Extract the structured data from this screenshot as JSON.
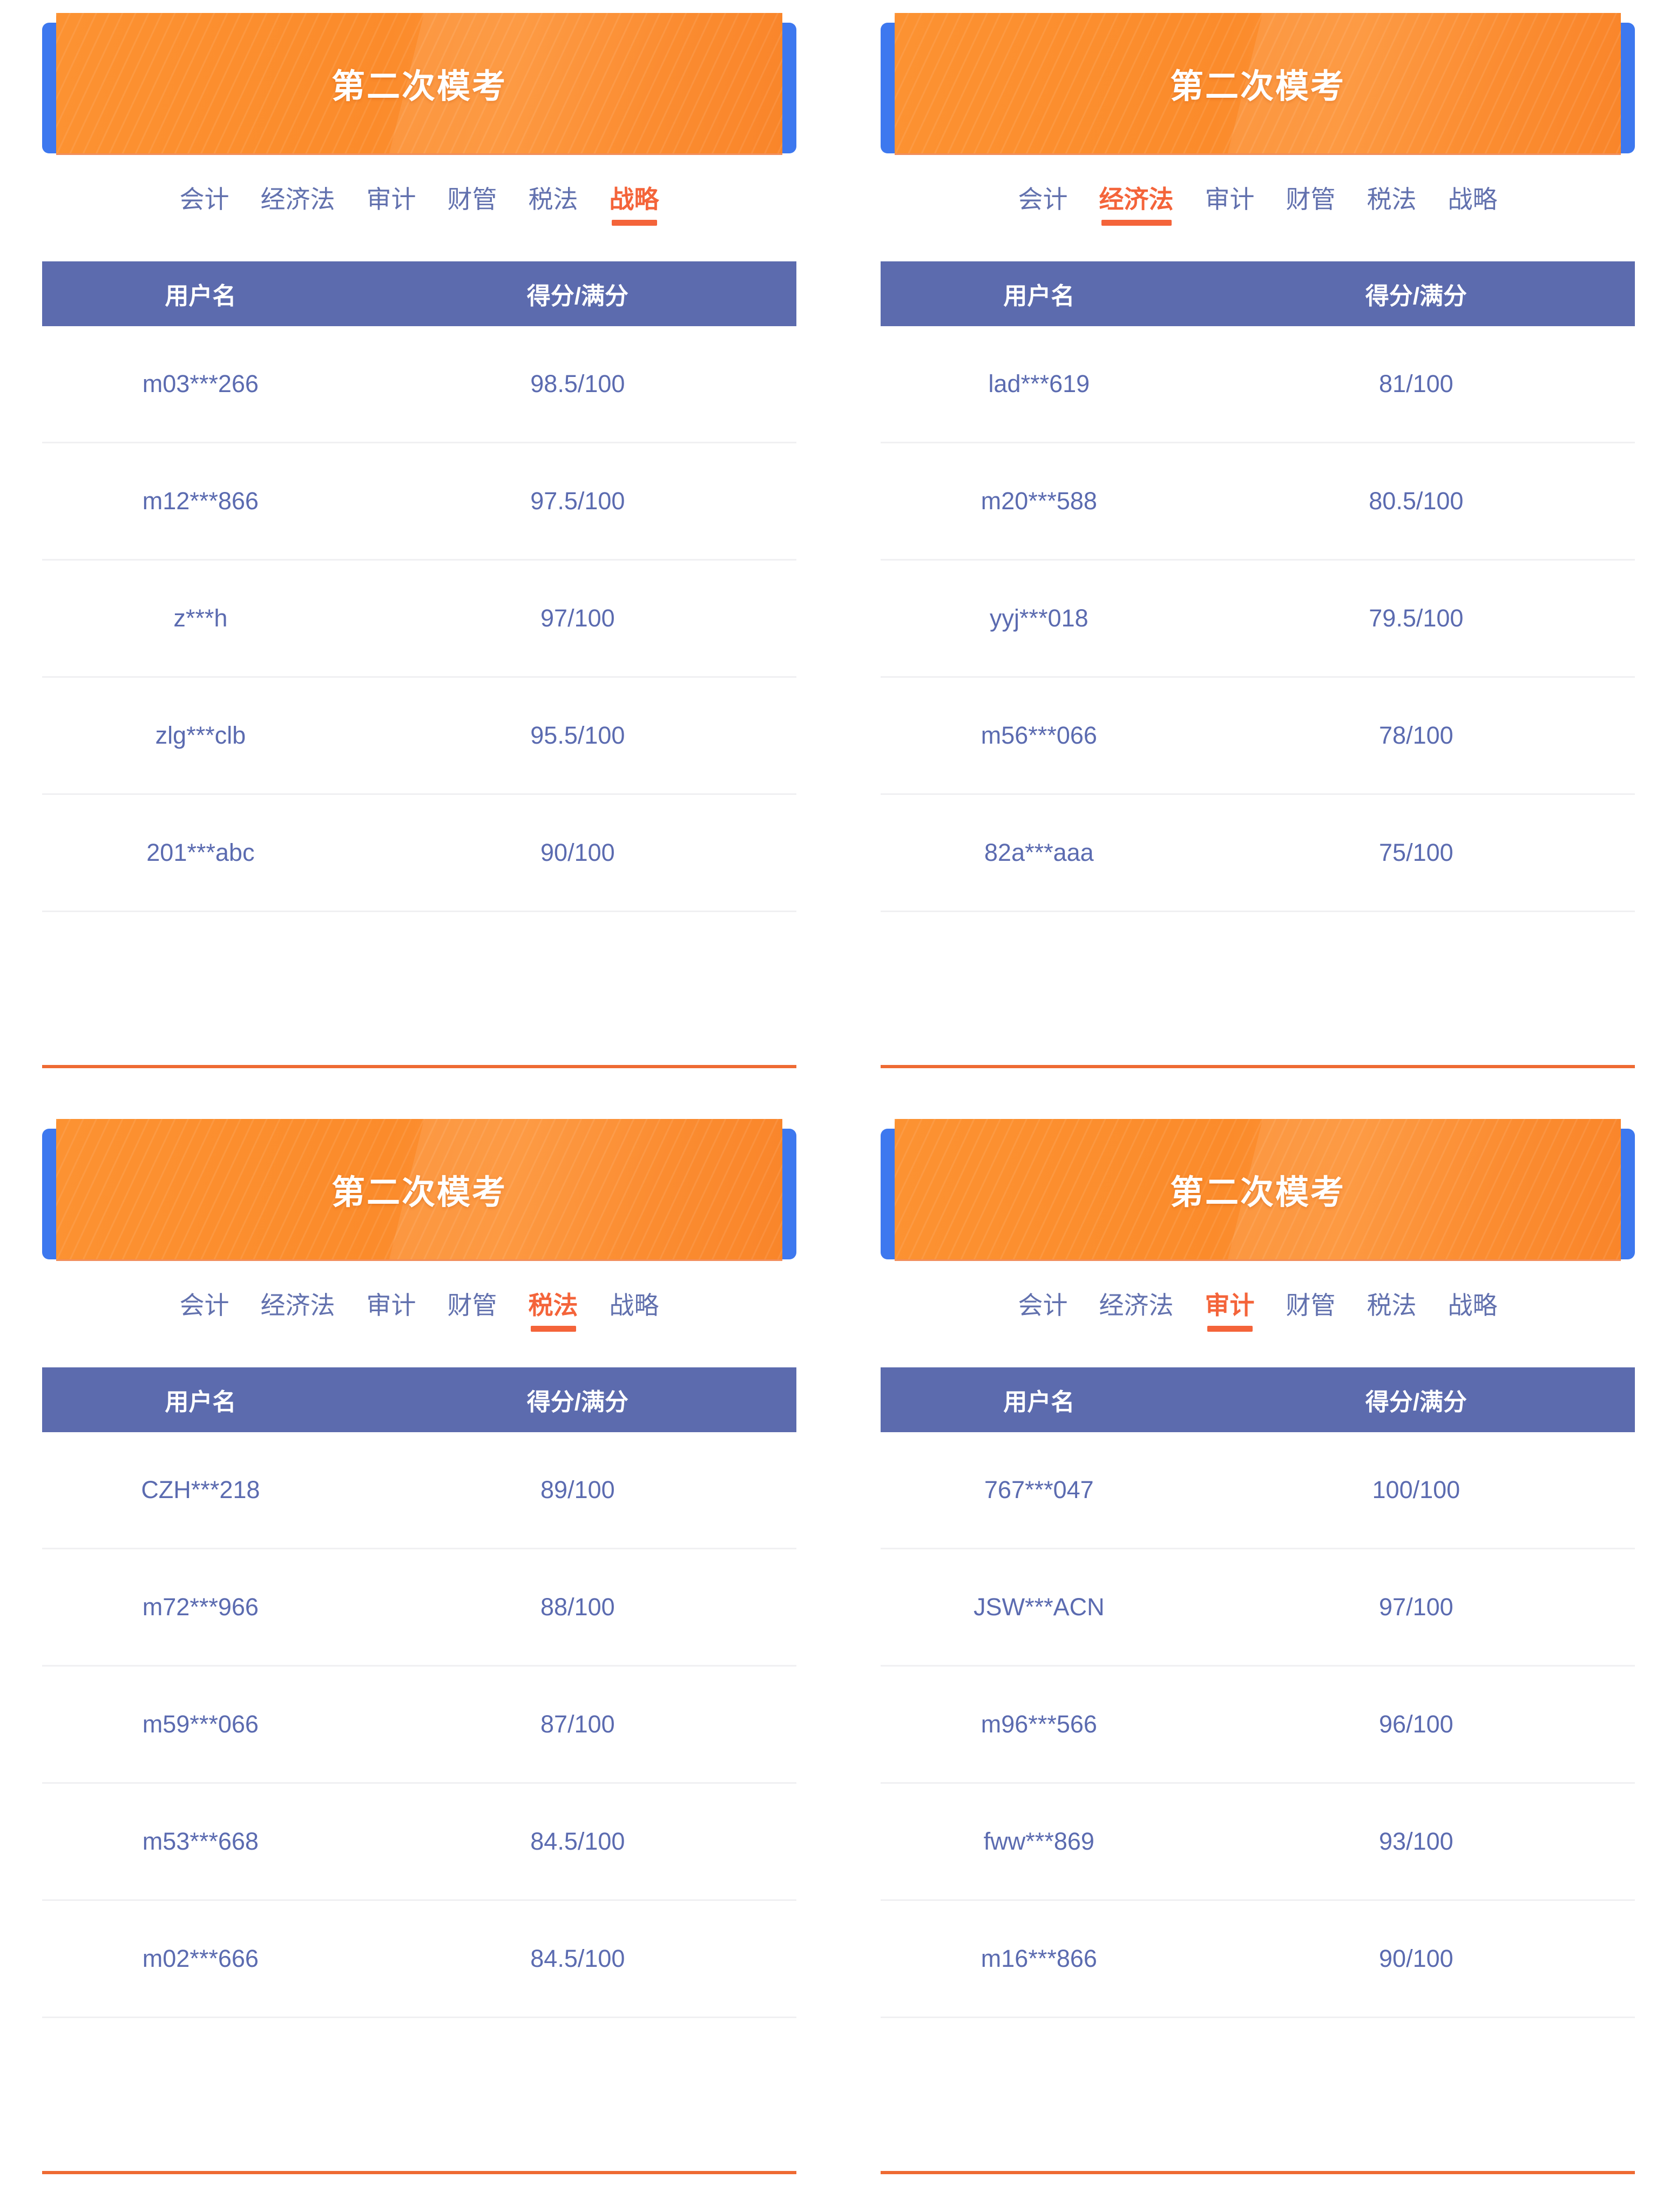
{
  "accent_colors": {
    "banner_orange": "#fb8b2b",
    "banner_ear_blue": "#3d78ef",
    "active_tab_orange": "#f4643a",
    "table_header_blue": "#5c6bae",
    "row_text_blue": "#5b6bb0",
    "panel_divider_orange": "#ee6a33"
  },
  "panels": [
    {
      "banner_title": "第二次模考",
      "tabs": [
        {
          "label": "会计",
          "active": false
        },
        {
          "label": "经济法",
          "active": false
        },
        {
          "label": "审计",
          "active": false
        },
        {
          "label": "财管",
          "active": false
        },
        {
          "label": "税法",
          "active": false
        },
        {
          "label": "战略",
          "active": true
        }
      ],
      "columns": {
        "user": "用户名",
        "score": "得分/满分"
      },
      "rows": [
        {
          "user": "m03***266",
          "score": "98.5/100"
        },
        {
          "user": "m12***866",
          "score": "97.5/100"
        },
        {
          "user": "z***h",
          "score": "97/100"
        },
        {
          "user": "zlg***clb",
          "score": "95.5/100"
        },
        {
          "user": "201***abc",
          "score": "90/100"
        }
      ]
    },
    {
      "banner_title": "第二次模考",
      "tabs": [
        {
          "label": "会计",
          "active": false
        },
        {
          "label": "经济法",
          "active": true
        },
        {
          "label": "审计",
          "active": false
        },
        {
          "label": "财管",
          "active": false
        },
        {
          "label": "税法",
          "active": false
        },
        {
          "label": "战略",
          "active": false
        }
      ],
      "columns": {
        "user": "用户名",
        "score": "得分/满分"
      },
      "rows": [
        {
          "user": "lad***619",
          "score": "81/100"
        },
        {
          "user": "m20***588",
          "score": "80.5/100"
        },
        {
          "user": "yyj***018",
          "score": "79.5/100"
        },
        {
          "user": "m56***066",
          "score": "78/100"
        },
        {
          "user": "82a***aaa",
          "score": "75/100"
        }
      ]
    },
    {
      "banner_title": "第二次模考",
      "tabs": [
        {
          "label": "会计",
          "active": false
        },
        {
          "label": "经济法",
          "active": false
        },
        {
          "label": "审计",
          "active": false
        },
        {
          "label": "财管",
          "active": false
        },
        {
          "label": "税法",
          "active": true
        },
        {
          "label": "战略",
          "active": false
        }
      ],
      "columns": {
        "user": "用户名",
        "score": "得分/满分"
      },
      "rows": [
        {
          "user": "CZH***218",
          "score": "89/100"
        },
        {
          "user": "m72***966",
          "score": "88/100"
        },
        {
          "user": "m59***066",
          "score": "87/100"
        },
        {
          "user": "m53***668",
          "score": "84.5/100"
        },
        {
          "user": "m02***666",
          "score": "84.5/100"
        }
      ]
    },
    {
      "banner_title": "第二次模考",
      "tabs": [
        {
          "label": "会计",
          "active": false
        },
        {
          "label": "经济法",
          "active": false
        },
        {
          "label": "审计",
          "active": true
        },
        {
          "label": "财管",
          "active": false
        },
        {
          "label": "税法",
          "active": false
        },
        {
          "label": "战略",
          "active": false
        }
      ],
      "columns": {
        "user": "用户名",
        "score": "得分/满分"
      },
      "rows": [
        {
          "user": "767***047",
          "score": "100/100"
        },
        {
          "user": "JSW***ACN",
          "score": "97/100"
        },
        {
          "user": "m96***566",
          "score": "96/100"
        },
        {
          "user": "fww***869",
          "score": "93/100"
        },
        {
          "user": "m16***866",
          "score": "90/100"
        }
      ]
    }
  ]
}
